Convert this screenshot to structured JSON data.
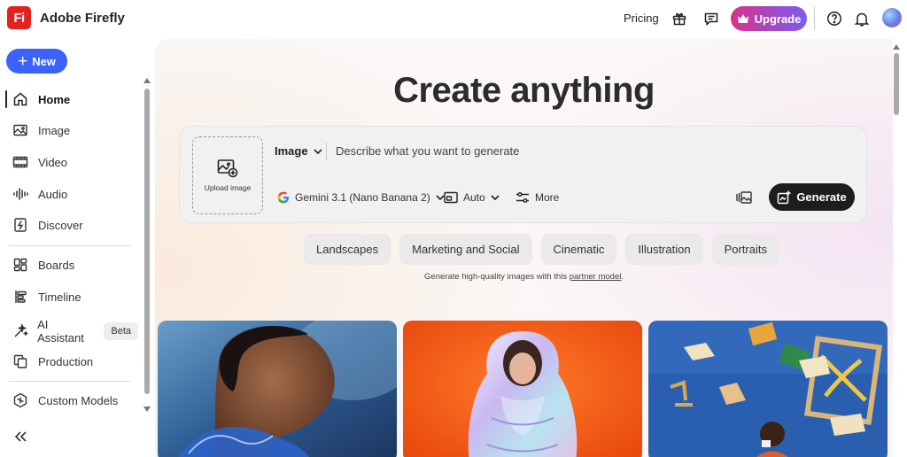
{
  "header": {
    "logo_text": "Fi",
    "app_title": "Adobe Firefly",
    "pricing_label": "Pricing",
    "upgrade_label": "Upgrade",
    "icons": [
      "gift-icon",
      "feedback-icon",
      "crown-icon",
      "help-icon",
      "bell-icon"
    ]
  },
  "sidebar": {
    "new_label": "New",
    "items": [
      {
        "label": "Home",
        "icon": "home-icon",
        "active": true
      },
      {
        "label": "Image",
        "icon": "image-icon"
      },
      {
        "label": "Video",
        "icon": "video-icon"
      },
      {
        "label": "Audio",
        "icon": "audio-icon"
      },
      {
        "label": "Discover",
        "icon": "discover-icon"
      },
      {
        "label": "Boards",
        "icon": "boards-icon"
      },
      {
        "label": "Timeline",
        "icon": "timeline-icon"
      },
      {
        "label": "AI Assistant",
        "icon": "ai-assistant-icon",
        "badge": "Beta"
      },
      {
        "label": "Production",
        "icon": "production-icon"
      },
      {
        "label": "Custom Models",
        "icon": "custom-models-icon"
      }
    ]
  },
  "main": {
    "headline": "Create anything",
    "prompt": {
      "upload_label": "Upload image",
      "mode": "Image",
      "placeholder": "Describe what you want to generate",
      "model": "Gemini 3.1 (Nano Banana 2)",
      "aspect": "Auto",
      "more_label": "More",
      "generate_label": "Generate"
    },
    "chips": [
      "Landscapes",
      "Marketing and Social",
      "Cinematic",
      "Illustration",
      "Portraits"
    ],
    "footnote_prefix": "Generate high-quality images with this",
    "footnote_link": "partner model",
    "footnote_suffix": ".",
    "colors": {
      "accent": "#3b63fb",
      "upgrade_from": "#d6338b",
      "upgrade_to": "#7b5cf0",
      "logo": "#e4211c"
    }
  }
}
